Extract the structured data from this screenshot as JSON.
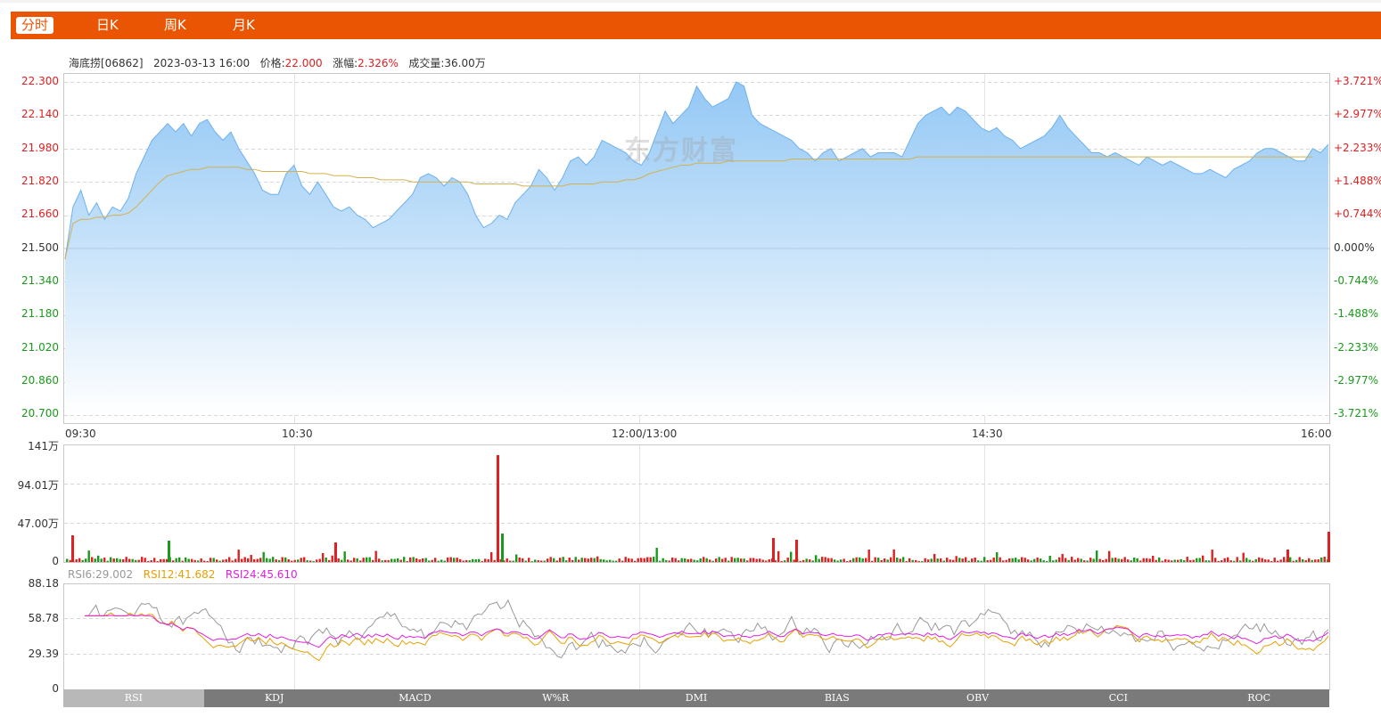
{
  "tabs": [
    {
      "label": "分时",
      "active": true
    },
    {
      "label": "日K",
      "active": false
    },
    {
      "label": "周K",
      "active": false
    },
    {
      "label": "月K",
      "active": false
    }
  ],
  "info": {
    "name": "海底捞[06862]",
    "datetime": "2023-03-13 16:00",
    "price_label": "价格:",
    "price": "22.000",
    "change_label": "涨幅:",
    "change": "2.326%",
    "volume_label": "成交量:",
    "volume": "36.00万"
  },
  "watermark": "东方财富",
  "price_axis": {
    "left": [
      "22.300",
      "22.140",
      "21.980",
      "21.820",
      "21.660",
      "21.500",
      "21.340",
      "21.180",
      "21.020",
      "20.860",
      "20.700"
    ],
    "right": [
      "+3.721%",
      "+2.977%",
      "+2.233%",
      "+1.488%",
      "+0.744%",
      "0.000%",
      "-0.744%",
      "-1.488%",
      "-2.233%",
      "-2.977%",
      "-3.721%"
    ],
    "time_labels": [
      "09:30",
      "10:30",
      "12:00/13:00",
      "14:30",
      "16:00"
    ]
  },
  "volume_axis": [
    "141万",
    "94.01万",
    "47.00万",
    "0"
  ],
  "rsi_axis": [
    "88.18",
    "58.78",
    "29.39",
    "0"
  ],
  "rsi_legend": {
    "rsi6": "RSI6:29.002",
    "rsi12": "RSI12:41.682",
    "rsi24": "RSI24:45.610",
    "color6": "#999999",
    "color12": "#e8a000",
    "color24": "#e020e0"
  },
  "indicator_tabs": [
    "RSI",
    "KDJ",
    "MACD",
    "W%R",
    "DMI",
    "BIAS",
    "OBV",
    "CCI",
    "ROC"
  ],
  "colors": {
    "brand": "#ea5504",
    "up": "#e02020",
    "down": "#1a9a1a",
    "price_line": "#6db1ef",
    "avg_line": "#d4b050"
  },
  "chart_data": {
    "type": "line",
    "prev_close": 21.5,
    "ylim": [
      20.7,
      22.3
    ],
    "x": [
      "09:30",
      "10:30",
      "12:00/13:00",
      "14:30",
      "16:00"
    ],
    "series": [],
    "price": [
      21.45,
      21.7,
      21.78,
      21.66,
      21.72,
      21.64,
      21.7,
      21.68,
      21.74,
      21.86,
      21.94,
      22.02,
      22.06,
      22.1,
      22.06,
      22.1,
      22.04,
      22.1,
      22.12,
      22.06,
      22.02,
      22.06,
      21.98,
      21.92,
      21.86,
      21.78,
      21.76,
      21.76,
      21.86,
      21.9,
      21.8,
      21.76,
      21.82,
      21.76,
      21.7,
      21.68,
      21.7,
      21.66,
      21.64,
      21.6,
      21.62,
      21.64,
      21.68,
      21.72,
      21.76,
      21.84,
      21.86,
      21.84,
      21.8,
      21.84,
      21.82,
      21.76,
      21.66,
      21.6,
      21.62,
      21.66,
      21.64,
      21.72,
      21.76,
      21.8,
      21.88,
      21.84,
      21.78,
      21.84,
      21.92,
      21.94,
      21.9,
      21.94,
      22.02,
      22.0,
      21.98,
      21.96,
      21.92,
      21.9,
      21.96,
      22.06,
      22.16,
      22.1,
      22.14,
      22.18,
      22.28,
      22.22,
      22.18,
      22.2,
      22.22,
      22.3,
      22.28,
      22.14,
      22.1,
      22.08,
      22.06,
      22.04,
      22.02,
      21.98,
      21.96,
      21.92,
      21.96,
      21.98,
      21.92,
      21.94,
      21.96,
      21.98,
      21.94,
      21.96,
      21.96,
      21.96,
      21.94,
      22.02,
      22.1,
      22.14,
      22.16,
      22.18,
      22.14,
      22.18,
      22.16,
      22.12,
      22.08,
      22.06,
      22.08,
      22.04,
      22.02,
      21.98,
      22.0,
      22.02,
      22.04,
      22.08,
      22.14,
      22.08,
      22.04,
      22.0,
      21.96,
      21.96,
      21.94,
      21.96,
      21.94,
      21.92,
      21.9,
      21.94,
      21.92,
      21.9,
      21.92,
      21.9,
      21.88,
      21.86,
      21.86,
      21.88,
      21.86,
      21.84,
      21.88,
      21.9,
      21.92,
      21.96,
      21.98,
      21.98,
      21.96,
      21.94,
      21.92,
      21.92,
      21.98,
      21.96,
      22.0
    ],
    "avg": [
      21.45,
      21.62,
      21.64,
      21.64,
      21.65,
      21.65,
      21.66,
      21.66,
      21.67,
      21.7,
      21.74,
      21.78,
      21.82,
      21.85,
      21.86,
      21.87,
      21.88,
      21.88,
      21.89,
      21.89,
      21.89,
      21.89,
      21.89,
      21.88,
      21.88,
      21.87,
      21.87,
      21.87,
      21.87,
      21.87,
      21.87,
      21.86,
      21.86,
      21.86,
      21.85,
      21.85,
      21.85,
      21.84,
      21.84,
      21.84,
      21.83,
      21.83,
      21.83,
      21.83,
      21.82,
      21.82,
      21.82,
      21.82,
      21.82,
      21.82,
      21.82,
      21.82,
      21.81,
      21.81,
      21.81,
      21.81,
      21.81,
      21.81,
      21.8,
      21.8,
      21.8,
      21.8,
      21.8,
      21.8,
      21.81,
      21.81,
      21.81,
      21.81,
      21.82,
      21.82,
      21.82,
      21.83,
      21.83,
      21.84,
      21.86,
      21.87,
      21.88,
      21.89,
      21.9,
      21.9,
      21.91,
      21.91,
      21.91,
      21.91,
      21.92,
      21.92,
      21.92,
      21.92,
      21.92,
      21.92,
      21.92,
      21.92,
      21.93,
      21.93,
      21.93,
      21.93,
      21.93,
      21.93,
      21.93,
      21.93,
      21.93,
      21.93,
      21.93,
      21.93,
      21.93,
      21.93,
      21.93,
      21.93,
      21.94,
      21.94,
      21.94,
      21.94,
      21.94,
      21.94,
      21.94,
      21.94,
      21.94,
      21.94,
      21.94,
      21.94,
      21.94,
      21.94,
      21.94,
      21.94,
      21.94,
      21.94,
      21.94,
      21.94,
      21.94,
      21.94,
      21.94,
      21.94,
      21.94,
      21.94,
      21.94,
      21.94,
      21.94,
      21.94,
      21.94,
      21.94,
      21.94,
      21.94,
      21.94,
      21.94,
      21.94,
      21.94,
      21.94,
      21.94,
      21.94,
      21.94,
      21.94,
      21.94,
      21.94,
      21.94,
      21.94,
      21.94,
      21.94,
      21.94,
      21.94
    ]
  }
}
